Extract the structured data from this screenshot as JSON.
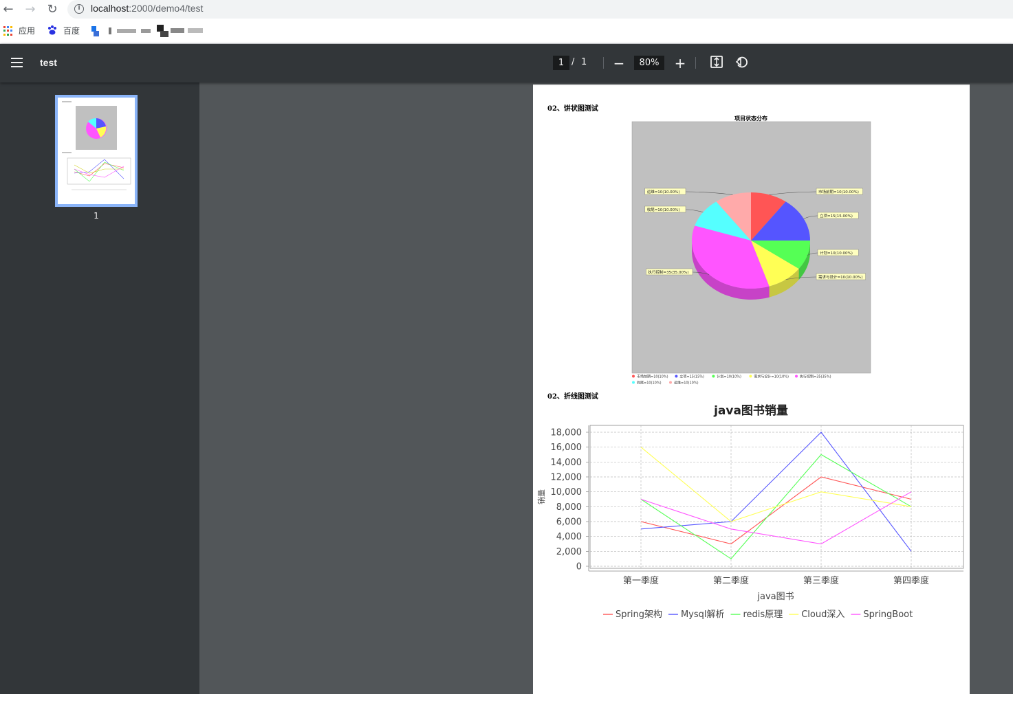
{
  "browser": {
    "url_host": "localhost",
    "url_path": ":2000/demo4/test",
    "bookmarks": [
      {
        "label": "应用"
      },
      {
        "label": "百度"
      }
    ]
  },
  "viewer": {
    "title": "test",
    "current_page": "1",
    "page_sep": "/",
    "total_pages": "1",
    "zoom": "80%",
    "thumbnail_label": "1"
  },
  "doc": {
    "section1_title": "02、饼状图测试",
    "section2_title": "02、折线图测试"
  },
  "chart_data": [
    {
      "type": "pie",
      "title": "项目状态分布",
      "slices": [
        {
          "label": "市场前期=10(10.00%)",
          "legend": "市场前期=10(10%)",
          "value": 10,
          "color": "#ff5555"
        },
        {
          "label": "立项=15(15.00%)",
          "legend": "立项=15(15%)",
          "value": 15,
          "color": "#5555ff"
        },
        {
          "label": "计划=10(10.00%)",
          "legend": "计划=10(10%)",
          "value": 10,
          "color": "#55ff55"
        },
        {
          "label": "需求与设计=10(10.00%)",
          "legend": "需求与设计=10(10%)",
          "value": 10,
          "color": "#ffff55"
        },
        {
          "label": "执行控制=35(35.00%)",
          "legend": "执行控制=35(35%)",
          "value": 35,
          "color": "#ff55ff"
        },
        {
          "label": "收尾=10(10.00%)",
          "legend": "收尾=10(10%)",
          "value": 10,
          "color": "#55ffff"
        },
        {
          "label": "运维=10(10.00%)",
          "legend": "运维=10(10%)",
          "value": 10,
          "color": "#ffaaaa"
        }
      ],
      "background": "#c0c0c0",
      "legend_position": "bottom"
    },
    {
      "type": "line",
      "title": "java图书销量",
      "xlabel": "java图书",
      "ylabel": "销量",
      "categories": [
        "第一季度",
        "第二季度",
        "第三季度",
        "第四季度"
      ],
      "ylim": [
        0,
        18000
      ],
      "yticks": [
        "0",
        "2,000",
        "4,000",
        "6,000",
        "8,000",
        "10,000",
        "12,000",
        "14,000",
        "16,000",
        "18,000"
      ],
      "grid": true,
      "legend_position": "bottom",
      "series": [
        {
          "name": "Spring架构",
          "values": [
            6000,
            3000,
            12000,
            9000
          ],
          "color": "#ff5555"
        },
        {
          "name": "Mysql解析",
          "values": [
            5000,
            6000,
            18000,
            2000
          ],
          "color": "#5555ff"
        },
        {
          "name": "redis原理",
          "values": [
            9000,
            1000,
            15000,
            8000
          ],
          "color": "#55ff55"
        },
        {
          "name": "Cloud深入",
          "values": [
            16000,
            6000,
            10000,
            8000
          ],
          "color": "#ffff55"
        },
        {
          "name": "SpringBoot",
          "values": [
            9000,
            5000,
            3000,
            10000
          ],
          "color": "#ff55ff"
        }
      ]
    }
  ]
}
